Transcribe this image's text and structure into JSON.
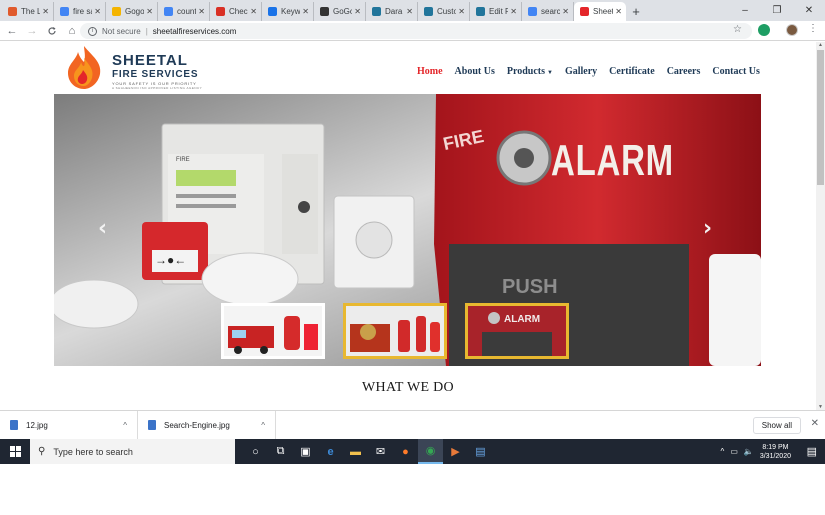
{
  "browser": {
    "tabs": [
      {
        "title": "The Li",
        "favicon_color": "#e05a2c",
        "active": false
      },
      {
        "title": "fire sa",
        "favicon_color": "#4285f4",
        "active": false
      },
      {
        "title": "Gogo",
        "favicon_color": "#f4b400",
        "active": false
      },
      {
        "title": "count",
        "favicon_color": "#4285f4",
        "active": false
      },
      {
        "title": "Check",
        "favicon_color": "#d93025",
        "active": false
      },
      {
        "title": "Keyw",
        "favicon_color": "#1a73e8",
        "active": false
      },
      {
        "title": "GoGo",
        "favicon_color": "#333333",
        "active": false
      },
      {
        "title": "Dara",
        "favicon_color": "#21759b",
        "active": false
      },
      {
        "title": "Custo",
        "favicon_color": "#21759b",
        "active": false
      },
      {
        "title": "Edit F",
        "favicon_color": "#21759b",
        "active": false
      },
      {
        "title": "search",
        "favicon_color": "#4285f4",
        "active": false
      },
      {
        "title": "Sheet",
        "favicon_color": "#e4262a",
        "active": true
      }
    ],
    "new_tab_label": "+",
    "window_controls": {
      "minimize": "–",
      "restore": "❐",
      "close": "✕"
    },
    "address": {
      "security_label": "Not secure",
      "url": "sheetalfireservices.com"
    },
    "nav_icons": {
      "back": "←",
      "forward": "→",
      "reload": "C",
      "home": "⌂",
      "star": "☆",
      "menu": "⋮"
    }
  },
  "site": {
    "logo": {
      "line1": "SHEETAL",
      "line2": "FIRE SERVICES",
      "tagline": "YOUR SAFETY IS OUR PRIORITY",
      "subline": "A SHAHEESON ISO APPROVED LISTING AGENCY"
    },
    "nav": [
      {
        "label": "Home",
        "active": true
      },
      {
        "label": "About Us",
        "active": false
      },
      {
        "label": "Products",
        "active": false,
        "dropdown": true
      },
      {
        "label": "Gallery",
        "active": false
      },
      {
        "label": "Certificate",
        "active": false
      },
      {
        "label": "Careers",
        "active": false
      },
      {
        "label": "Contact Us",
        "active": false
      }
    ],
    "slider": {
      "prev": "‹",
      "next": "›",
      "panel_text": "FIRE",
      "alarm_text": "ALARM",
      "push_text": "PUSH",
      "side_text": "FIRE"
    },
    "section_title": "WHAT WE DO"
  },
  "downloads": {
    "items": [
      {
        "name": "12.jpg"
      },
      {
        "name": "Search-Engine.jpg"
      }
    ],
    "show_all": "Show all"
  },
  "taskbar": {
    "search_placeholder": "Type here to search",
    "time": "8:19 PM",
    "date": "3/31/2020"
  },
  "colors": {
    "brand_navy": "#1f3a56",
    "brand_red": "#e4262a",
    "thumb_selected": "#e8b830"
  }
}
